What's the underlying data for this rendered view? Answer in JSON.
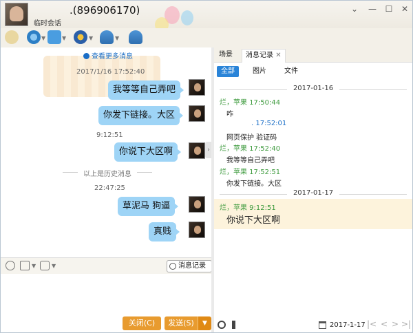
{
  "window": {
    "contact_name": ".(896906170)",
    "subtitle": "临时会话",
    "controls": [
      "⌄",
      "—",
      "☐",
      "✕"
    ]
  },
  "chat": {
    "view_more": "查看更多消息",
    "history_divider": "以上是历史消息",
    "messages": [
      {
        "time": "2017/1/16 17:52:40",
        "text": "我等等自己弄吧"
      },
      {
        "time": "",
        "text": "你发下链接。大区"
      },
      {
        "time": "9:12:51",
        "text": "你说下大区啊"
      },
      {
        "time": "22:47:25",
        "text": "草泥马  狗逼"
      },
      {
        "time": "",
        "text": "真贱"
      }
    ]
  },
  "input_toolbar": {
    "history_button": "消息记录"
  },
  "buttons": {
    "close": "关闭(C)",
    "send": "发送(S)",
    "send_dropdown": "▼"
  },
  "right_panel": {
    "tabs": [
      "场景",
      "消息记录"
    ],
    "tab_close": "✕",
    "filters": [
      "全部",
      "图片",
      "文件"
    ],
    "date1": "2017-01-16",
    "date2": "2017-01-17",
    "records": [
      {
        "meta": "烂，苹果 17:50:44",
        "text": "咋",
        "color": "green"
      },
      {
        "meta": ". 17:52:01",
        "text": "网页保护 验证码",
        "color": "blue"
      },
      {
        "meta": "烂，苹果 17:52:40",
        "text": "我等等自己弄吧",
        "color": "green"
      },
      {
        "meta": "烂，苹果 17:52:51",
        "text": "你发下链接。大区",
        "color": "green"
      },
      {
        "meta": "烂，苹果 9:12:51",
        "text": "你说下大区啊",
        "color": "green"
      }
    ],
    "footer_date": "2017-1-17",
    "nav": [
      "|<",
      "<",
      ">",
      ">|"
    ]
  },
  "colors": {
    "bubble": "#9ed4f6",
    "accent_orange": "#e89b2f",
    "accent_blue": "#2a84d8",
    "meta_green": "#3c9a3c"
  }
}
